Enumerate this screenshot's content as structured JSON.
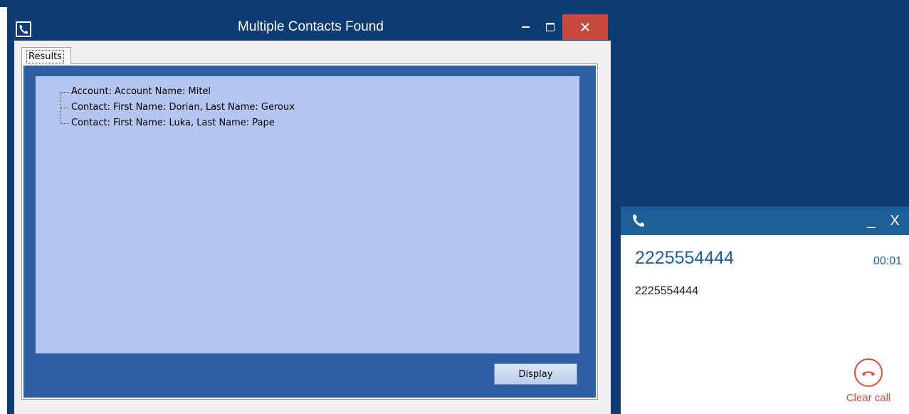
{
  "multiple_contacts_window": {
    "title": "Multiple Contacts Found",
    "tabs": [
      {
        "label": "Results"
      }
    ],
    "results": [
      {
        "label": "Account: Account Name: Mitel"
      },
      {
        "label": "Contact: First Name: Dorian, Last Name: Geroux"
      },
      {
        "label": "Contact: First Name: Luka, Last Name: Pape"
      }
    ],
    "display_button": "Display"
  },
  "call_panel": {
    "number": "2225554444",
    "timer": "00:01",
    "caller_detail": "2225554444",
    "clear_call_label": "Clear call",
    "close_symbol": "X",
    "minimize_symbol": "_"
  },
  "colors": {
    "desktop": "#0e3b73",
    "call_header": "#1d5f9b",
    "results_panel": "#2e5fa4",
    "results_tree": "#b4c6ef",
    "close_button": "#c9463d",
    "clear_call": "#e04b3c"
  },
  "icons": {
    "app_icon": "phone-icon",
    "call_icon": "phone-icon",
    "clear_call_icon": "hang-up-icon"
  }
}
